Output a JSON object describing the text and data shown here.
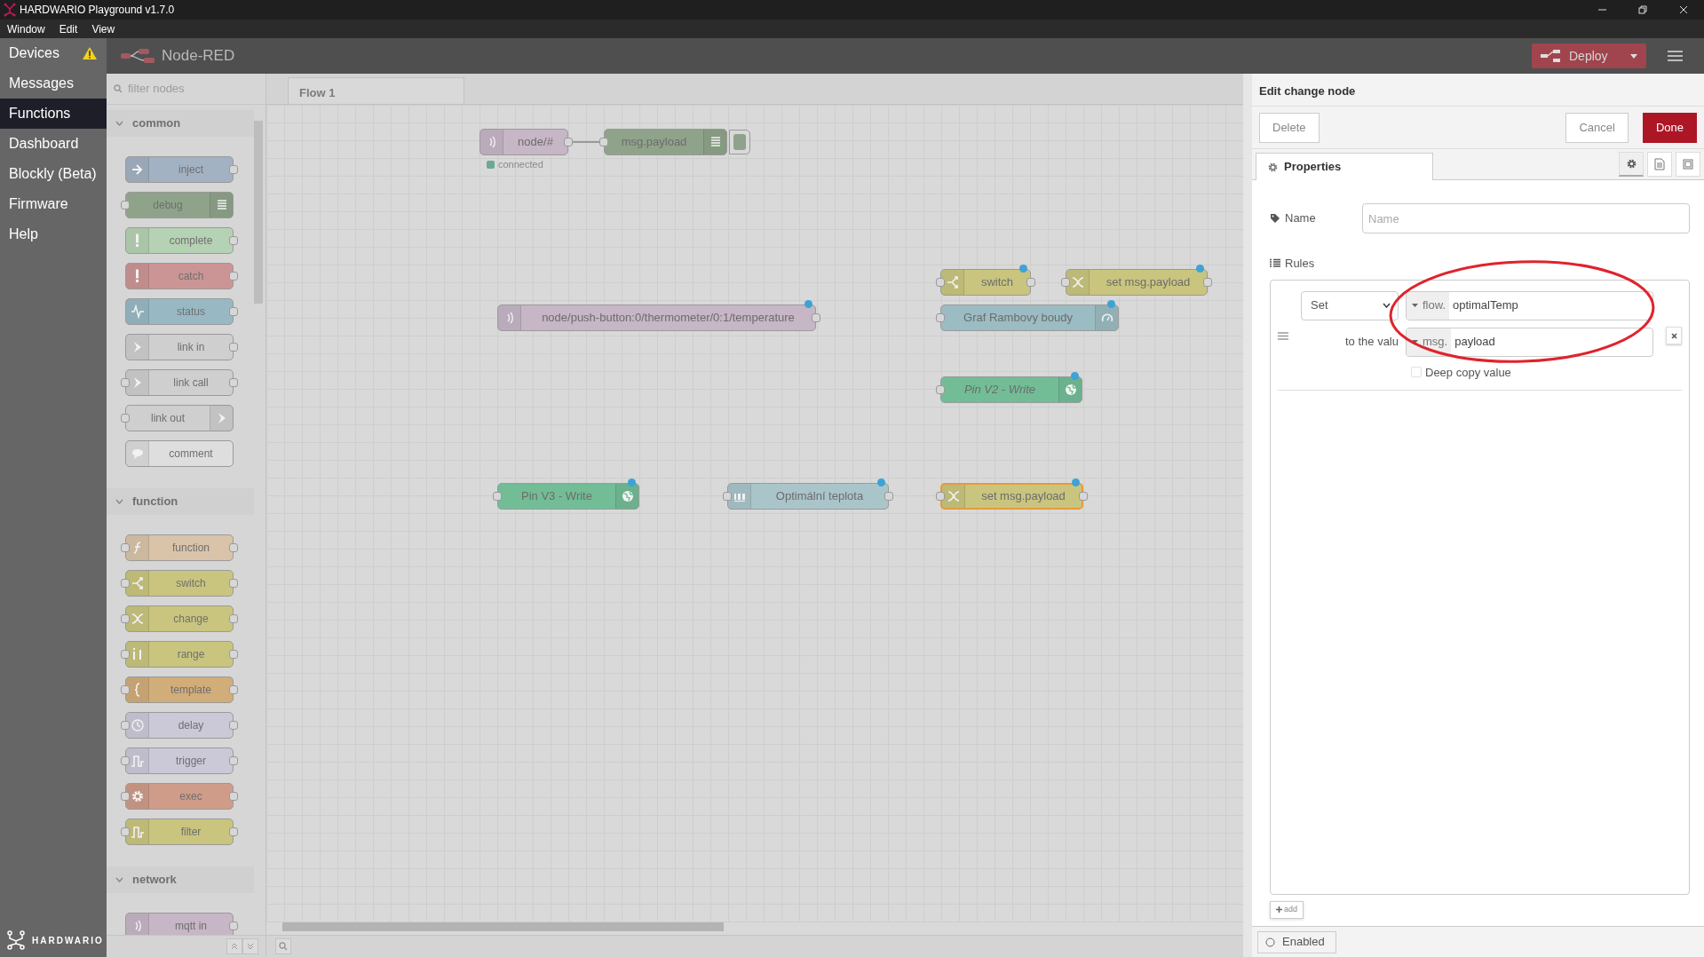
{
  "window": {
    "title": "HARDWARIO Playground v1.7.0"
  },
  "menu": [
    "Window",
    "Edit",
    "View"
  ],
  "sidebar": {
    "items": [
      {
        "label": "Devices",
        "selected": false,
        "warning": true
      },
      {
        "label": "Messages",
        "selected": false,
        "warning": false
      },
      {
        "label": "Functions",
        "selected": true,
        "warning": false
      },
      {
        "label": "Dashboard",
        "selected": false,
        "warning": false
      },
      {
        "label": "Blockly (Beta)",
        "selected": false,
        "warning": false
      },
      {
        "label": "Firmware",
        "selected": false,
        "warning": false
      },
      {
        "label": "Help",
        "selected": false,
        "warning": false
      }
    ],
    "logo": "HARDWARIO"
  },
  "header": {
    "title": "Node-RED",
    "deploy": "Deploy"
  },
  "palette": {
    "placeholder": "filter nodes",
    "categories": [
      {
        "label": "common",
        "expanded": true,
        "nodes": [
          {
            "label": "inject",
            "kind": "inject",
            "color": "#a3b2c2"
          },
          {
            "label": "debug",
            "kind": "debug",
            "color": "#8fa38a"
          },
          {
            "label": "complete",
            "kind": "complete",
            "color": "#b6d2b4"
          },
          {
            "label": "catch",
            "kind": "catch",
            "color": "#cc9595"
          },
          {
            "label": "status",
            "kind": "status",
            "color": "#98b9c4"
          },
          {
            "label": "link in",
            "kind": "linkin",
            "color": "#cfcfcf"
          },
          {
            "label": "link call",
            "kind": "linkcall",
            "color": "#cfcfcf"
          },
          {
            "label": "link out",
            "kind": "linkout",
            "color": "#cfcfcf"
          },
          {
            "label": "comment",
            "kind": "comment",
            "color": "#dedede"
          }
        ]
      },
      {
        "label": "function",
        "expanded": true,
        "nodes": [
          {
            "label": "function",
            "kind": "function",
            "color": "#d9c3a9"
          },
          {
            "label": "switch",
            "kind": "switch",
            "color": "#c9c57f"
          },
          {
            "label": "change",
            "kind": "change",
            "color": "#c9c57f"
          },
          {
            "label": "range",
            "kind": "range",
            "color": "#c9c57f"
          },
          {
            "label": "template",
            "kind": "template",
            "color": "#d1ad7a"
          },
          {
            "label": "delay",
            "kind": "delay",
            "color": "#cbc8d8"
          },
          {
            "label": "trigger",
            "kind": "trigger",
            "color": "#cbc8d8"
          },
          {
            "label": "exec",
            "kind": "exec",
            "color": "#cf9c8a"
          },
          {
            "label": "filter",
            "kind": "filter",
            "color": "#c9c57f"
          }
        ]
      },
      {
        "label": "network",
        "expanded": true,
        "nodes": [
          {
            "label": "mqtt in",
            "kind": "mqttin",
            "color": "#c6b6c6"
          }
        ]
      }
    ]
  },
  "workspace": {
    "tabs": [
      {
        "label": "Flow 1",
        "selected": true
      }
    ],
    "nodes": [
      {
        "label": "node/#",
        "kind": "mqttin",
        "color": "#c6b6c6",
        "selected": false,
        "changed": false,
        "italic": false,
        "status": "connected"
      },
      {
        "label": "msg.payload",
        "kind": "debug",
        "color": "#8fa38a",
        "selected": false,
        "changed": false,
        "italic": false
      },
      {
        "label": "switch",
        "kind": "switch",
        "color": "#c9c57f",
        "selected": false,
        "changed": true,
        "italic": false
      },
      {
        "label": "set msg.payload",
        "kind": "change",
        "color": "#c9c57f",
        "selected": false,
        "changed": true,
        "italic": false
      },
      {
        "label": "node/push-button:0/thermometer/0:1/temperature",
        "kind": "mqttin",
        "color": "#c6b6c6",
        "selected": false,
        "changed": true,
        "italic": false
      },
      {
        "label": "Graf Rambovy boudy",
        "kind": "gauge",
        "color": "#9bbcc2",
        "selected": false,
        "changed": true,
        "italic": false
      },
      {
        "label": "Pin V2 - Write",
        "kind": "blynk",
        "color": "#72bd96",
        "selected": false,
        "changed": true,
        "italic": true
      },
      {
        "label": "Pin V3 - Write",
        "kind": "blynk",
        "color": "#72bd96",
        "selected": false,
        "changed": true,
        "italic": false
      },
      {
        "label": "Optimální teplota",
        "kind": "numeric",
        "color": "#aac5ca",
        "selected": false,
        "changed": true,
        "italic": false
      },
      {
        "label": "set msg.payload",
        "kind": "change",
        "color": "#c9c57f",
        "selected": true,
        "changed": true,
        "italic": false
      }
    ]
  },
  "editor": {
    "title": "Edit change node",
    "delete": "Delete",
    "cancel": "Cancel",
    "done": "Done",
    "tabs": [
      {
        "label": "Properties",
        "selected": true
      }
    ],
    "name": {
      "label": "Name",
      "placeholder": "Name"
    },
    "rules_label": "Rules",
    "rules": [
      {
        "action": "Set",
        "target_type": "flow.",
        "target": "optimalTemp",
        "value_label": "to the valu",
        "value_type": "msg.",
        "value": "payload",
        "deep_copy": {
          "label": "Deep copy value",
          "checked": false
        }
      }
    ],
    "add": "add",
    "enabled": {
      "label": "Enabled",
      "checked": false
    }
  }
}
